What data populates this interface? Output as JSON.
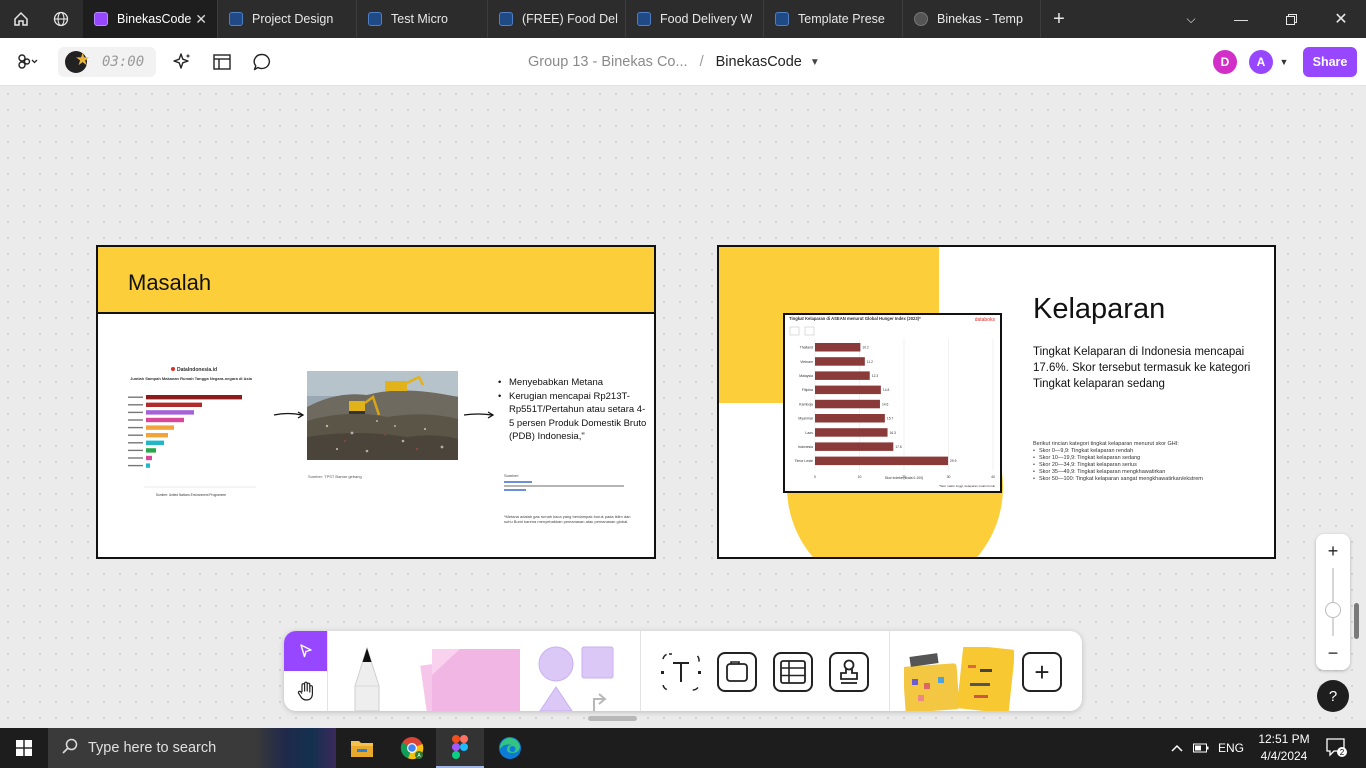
{
  "browser": {
    "tabs": [
      {
        "label": "BinekasCode",
        "active": true
      },
      {
        "label": "Project Design"
      },
      {
        "label": "Test Micro"
      },
      {
        "label": "(FREE) Food Del"
      },
      {
        "label": "Food Delivery W"
      },
      {
        "label": "Template Prese"
      },
      {
        "label": "Binekas - Temp"
      }
    ]
  },
  "toolbar": {
    "timer": "03:00",
    "breadcrumb_parent": "Group 13 - Binekas Co...",
    "breadcrumb_sep": "/",
    "breadcrumb_current": "BinekasCode",
    "avatars": [
      {
        "letter": "D",
        "color": "#d12fc7"
      },
      {
        "letter": "A",
        "color": "#9747ff"
      }
    ],
    "share_label": "Share"
  },
  "slide1": {
    "title": "Masalah",
    "chart": {
      "brand": "DataIndonesia.id",
      "title": "Jumlah Sampah Makanan Rumah Tangga Negara-negara di Asia",
      "source": "Sumber: United Nations Environment Programme"
    },
    "photo_caption": "Sumber: TPST Bantar gebang",
    "bullets": [
      "Menyebabkan Metana",
      "Kerugian mencapai Rp213T-Rp551T/Pertahun atau setara 4-5 persen Produk Domestik Bruto (PDB) Indonesia,\""
    ],
    "sources_label": "Sumber:",
    "footnote": "*Metana adalah gas rumah kaca yang berdampak buruk pada iklim dan suhu Bumi karena menyebabkan pemanasan atau pemanasan global."
  },
  "slide2": {
    "title": "Kelaparan",
    "description": "Tingkat Kelaparan di Indonesia mencapai 17.6%. Skor tersebut termasuk ke kategori Tingkat kelaparan sedang",
    "rincian_title": "Berikut rincian kategori tingkat kelaparan menurut skor GHI:",
    "rincian": [
      "Skor 0—9,9: Tingkat kelaparan rendah",
      "Skor 10—19,9: Tingkat kelaparan sedang",
      "Skor 20—34,9: Tingkat kelaparan serius",
      "Skor 35—49,9: Tingkat kelaparan mengkhawatirkan",
      "Skor 50—100: Tingkat kelaparan sangat mengkhawatirkan/ekstrem"
    ],
    "chart_title": "Tingkat Kelaparan di ASEAN menurut Global Hunger Index (2023)*",
    "chart_brand": "databoks",
    "chart_xlabel": "Skor indeks (skala 0-100)",
    "chart_note": "*Skor makin tinggi, kelaparan makin buruk"
  },
  "chart_data": {
    "type": "bar",
    "orientation": "horizontal",
    "title": "Tingkat Kelaparan di ASEAN menurut Global Hunger Index (2023)*",
    "categories": [
      "Thailand",
      "Vietnam",
      "Malaysia",
      "Filipina",
      "Kamboja",
      "Myanmar",
      "Laos",
      "Indonesia",
      "Timor Leste"
    ],
    "values": [
      10.2,
      11.2,
      12.3,
      14.8,
      14.6,
      15.7,
      16.3,
      17.6,
      29.9
    ],
    "xlabel": "Skor indeks (skala 0-100)",
    "xticks": [
      0,
      10,
      20,
      30,
      40
    ],
    "xlim": [
      0,
      40
    ],
    "bar_color": "#8b3a3a"
  },
  "zoom": {
    "in": "+",
    "out": "−"
  },
  "help": "?",
  "taskbar": {
    "search_placeholder": "Type here to search",
    "language": "ENG",
    "time": "12:51 PM",
    "date": "4/4/2024",
    "notifications": "2"
  },
  "colors": {
    "accent": "#9747ff",
    "slide_yellow": "#fccf3a"
  }
}
